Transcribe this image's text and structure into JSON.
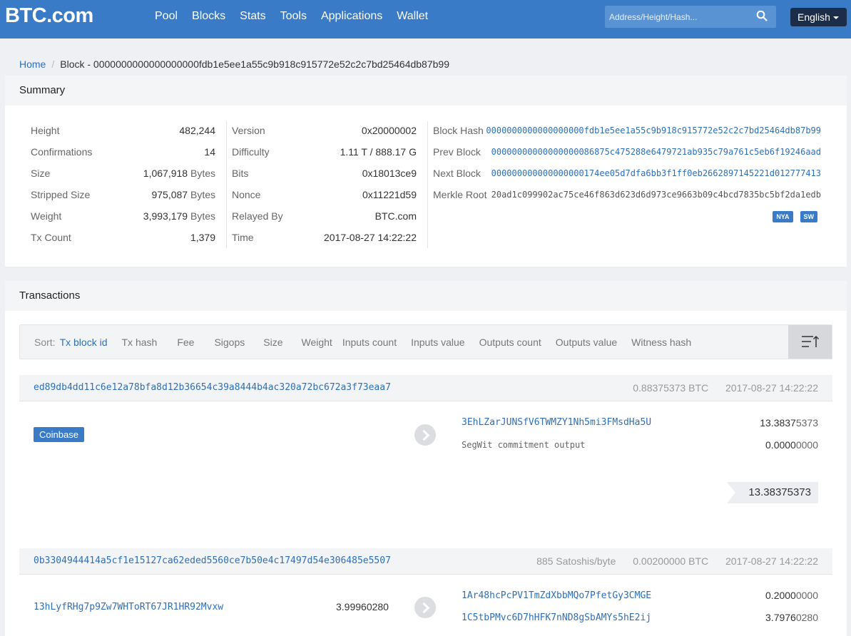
{
  "header": {
    "logo": "BTC.com",
    "nav": [
      "Pool",
      "Blocks",
      "Stats",
      "Tools",
      "Applications",
      "Wallet"
    ],
    "search_placeholder": "Address/Height/Hash...",
    "language": "English"
  },
  "breadcrumb": {
    "home": "Home",
    "current": "Block - 0000000000000000000fdb1e5ee1a55c9b918c915772e52c2c7bd25464db87b99"
  },
  "summary": {
    "title": "Summary",
    "col1": [
      {
        "label": "Height",
        "value": "482,244",
        "unit": ""
      },
      {
        "label": "Confirmations",
        "value": "14",
        "unit": ""
      },
      {
        "label": "Size",
        "value": "1,067,918",
        "unit": "Bytes"
      },
      {
        "label": "Stripped Size",
        "value": "975,087",
        "unit": "Bytes"
      },
      {
        "label": "Weight",
        "value": "3,993,179",
        "unit": "Bytes"
      },
      {
        "label": "Tx Count",
        "value": "1,379",
        "unit": ""
      }
    ],
    "col2": [
      {
        "label": "Version",
        "value": "0x20000002"
      },
      {
        "label": "Difficulty",
        "value": "1.11 T / 888.17 G"
      },
      {
        "label": "Bits",
        "value": "0x18013ce9"
      },
      {
        "label": "Nonce",
        "value": "0x11221d59"
      },
      {
        "label": "Relayed By",
        "value": "BTC.com"
      },
      {
        "label": "Time",
        "value": "2017-08-27 14:22:22"
      }
    ],
    "col3": [
      {
        "label": "Block Hash",
        "value": "0000000000000000000fdb1e5ee1a55c9b918c915772e52c2c7bd25464db87b99"
      },
      {
        "label": "Prev Block",
        "value": "00000000000000000086875c475288e6479721ab935c79a761c5eb6f19246aad"
      },
      {
        "label": "Next Block",
        "value": "000000000000000000174ee05d7dfa6bb3f1ff0eb2662897145221d012777413"
      },
      {
        "label": "Merkle Root",
        "value": "20ad1c099902ac75ce46f863d623d6d973ce9663b09c4bcd7835bc5bf2da1edb"
      }
    ],
    "badges": [
      "NYA",
      "SW"
    ]
  },
  "transactions": {
    "title": "Transactions",
    "sort_label": "Sort:",
    "sort_options": [
      "Tx block id",
      "Tx hash",
      "Fee",
      "Sigops",
      "Size",
      "Weight",
      "Inputs count",
      "Inputs value",
      "Outputs count",
      "Outputs value",
      "Witness hash"
    ],
    "tx1": {
      "hash": "ed89db4dd11c6e12a78bfa8d12b36654c39a8444b4ac320a72bc672a3f73eaa7",
      "amount": "0.88375373 BTC",
      "time": "2017-08-27 14:22:22",
      "input": "Coinbase",
      "outputs": [
        {
          "address": "3EhLZarJUNSfV6TWMZY1Nh5mi3FMsdHa5U",
          "amount_main": "13.3837",
          "amount_dim": "5373"
        },
        {
          "address": "SegWit commitment output",
          "amount_main": "0.0000",
          "amount_dim": "0000"
        }
      ],
      "total": "13.38375373"
    },
    "tx2": {
      "hash": "0b3304944414a5cf1e15127ca62eded5560ce7b50e4c17497d54e306485e5507",
      "fee_rate": "885 Satoshis/byte",
      "amount": "0.00200000 BTC",
      "time": "2017-08-27 14:22:22",
      "input": {
        "address": "13hLyfRHg7p9Zw7WHToRT67JR1HR92Mvxw",
        "amount_main": "3.9996",
        "amount_dim": "0280"
      },
      "outputs": [
        {
          "address": "1Ar48hcPcPV1TmZdXbbMQo7PfetGy3CMGE",
          "amount_main": "0.2000",
          "amount_dim": "0000"
        },
        {
          "address": "1C5tbPMvc6D7hHFK7nND8gSbAMYs5hE2ij",
          "amount_main": "3.7976",
          "amount_dim": "0280"
        }
      ]
    }
  }
}
